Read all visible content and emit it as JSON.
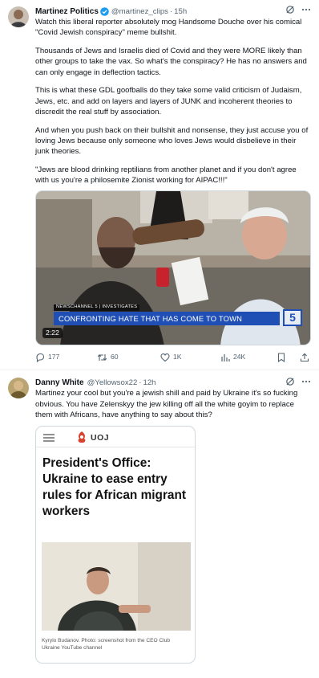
{
  "tweets": [
    {
      "name": "Martinez Politics",
      "handle": "@martinez_clips",
      "time": "15h",
      "paragraphs": [
        "Watch this liberal reporter absolutely mog Handsome Douche over his comical \"Covid Jewish conspiracy\" meme bullshit.",
        "Thousands of Jews and Israelis died of Covid and they were MORE likely than other groups to take the vax. So what's the conspiracy? He has no answers and can only engage in deflection tactics.",
        "This is what these GDL goofballs do they take some valid criticism of Judaism, Jews, etc. and add on layers and layers of JUNK and incoherent theories to discredit the real stuff by association.",
        "And when you push back on their bullshit and nonsense, they just accuse you of loving Jews because only someone who loves Jews would disbelieve in their junk theories.",
        "\"Jews are blood drinking reptilians from another planet and if you don't agree with us you're a philosemite Zionist working for AIPAC!!!\""
      ],
      "video": {
        "lower_third_kicker": "NEWSCHANNEL 5 | INVESTIGATES",
        "lower_third_headline": "CONFRONTING HATE THAT HAS COME TO TOWN",
        "station_badge": "5",
        "duration": "2:22"
      },
      "actions": {
        "replies": "177",
        "reposts": "60",
        "likes": "1K",
        "views": "24K"
      }
    },
    {
      "name": "Danny White",
      "handle": "@Yellowsox22",
      "time": "12h",
      "paragraphs": [
        "Martinez your cool but you're a jewish shill and paid by Ukraine it's so fucking obvious. You have Zelenskyy the jew killing off all the white goyim to replace them with Africans, have anything to say about this?"
      ],
      "article": {
        "site_logo": "UOJ",
        "headline": "President's Office: Ukraine to ease entry rules for African migrant workers",
        "caption": "Kyrylo Budanov. Photo: screenshot from the CEO Club Ukraine YouTube channel"
      }
    }
  ],
  "icons": [
    "verified-badge-icon",
    "grok-icon",
    "more-icon",
    "reply-icon",
    "repost-icon",
    "like-icon",
    "views-icon",
    "bookmark-icon",
    "share-icon",
    "hamburger-menu-icon",
    "uoj-emblem-icon"
  ],
  "colors": {
    "text": "#0f1419",
    "secondary": "#536471",
    "verified": "#1d9bf0",
    "divider": "#eff3f4",
    "lower_third": "#1f4fb5"
  }
}
